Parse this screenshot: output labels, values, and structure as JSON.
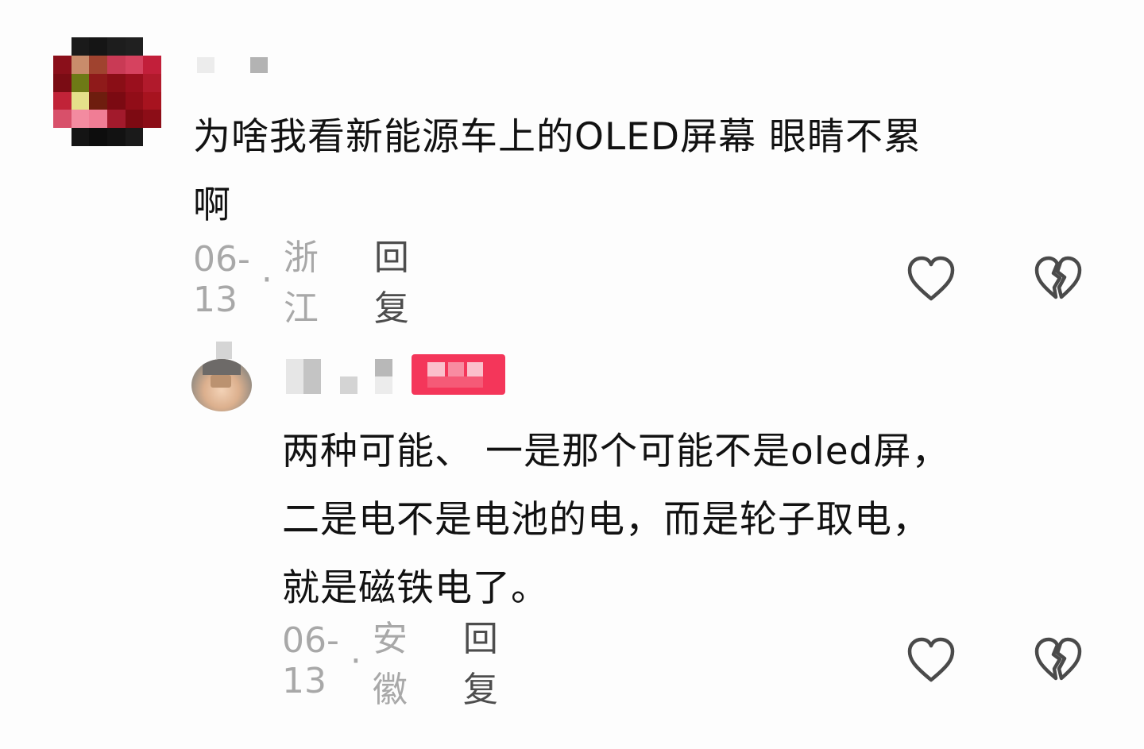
{
  "comments": [
    {
      "text": "为啥我看新能源车上的OLED屏幕 眼睛不累\n啊",
      "date": "06-13",
      "separator": "·",
      "location": "浙江",
      "reply_label": "回复"
    },
    {
      "text": "两种可能、 一是那个可能不是oled屏，\n二是电不是电池的电，而是轮子取电，\n就是磁铁电了。",
      "date": "06-13",
      "separator": "·",
      "location": "安徽",
      "reply_label": "回复"
    }
  ],
  "icons": {
    "like": "heart-outline-icon",
    "dislike": "broken-heart-outline-icon"
  },
  "colors": {
    "meta_text": "#a8a8a8",
    "reply_text": "#4d4d4d",
    "icon_stroke": "#4a4a4a",
    "badge": "#f4365a"
  }
}
